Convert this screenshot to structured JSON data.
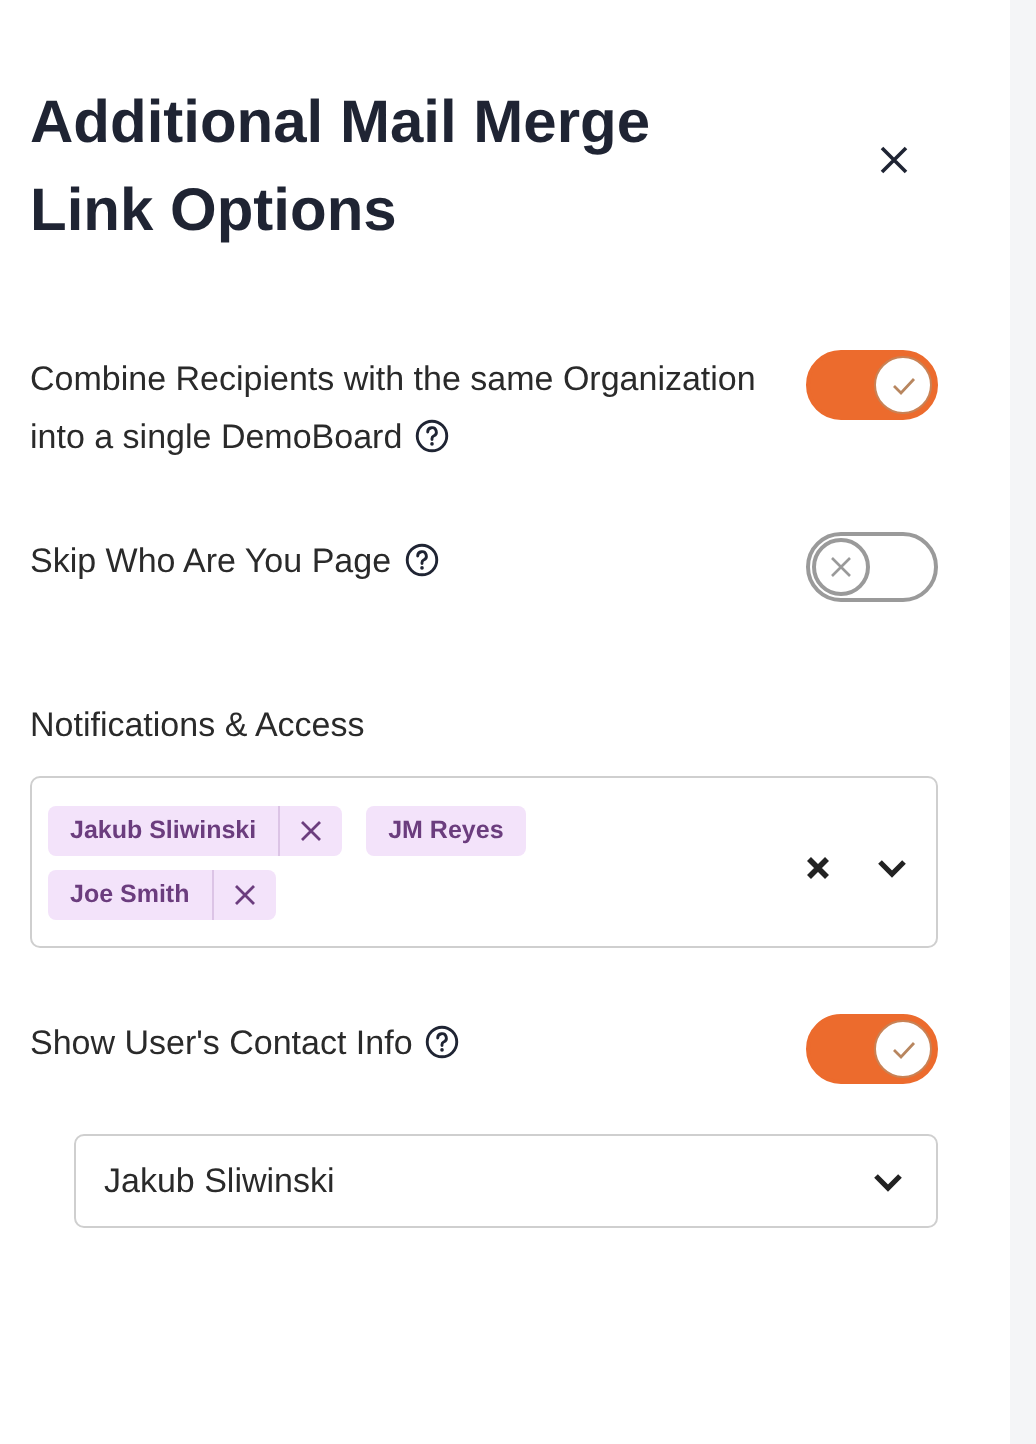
{
  "title": "Additional Mail Merge Link Options",
  "options_top": [
    {
      "label": "Combine Recipients with the same Organization into a single DemoBoard",
      "help": true,
      "on": true
    },
    {
      "label": "Skip Who Are You Page",
      "help": true,
      "on": false
    }
  ],
  "notifications": {
    "label": "Notifications & Access",
    "chips": [
      {
        "text": "Jakub Sliwinski",
        "removable": true
      },
      {
        "text": "JM Reyes",
        "removable": false
      },
      {
        "text": "Joe Smith",
        "removable": true
      }
    ]
  },
  "contact_info": {
    "label": "Show User's Contact Info",
    "help": true,
    "on": true,
    "select": {
      "value": "Jakub Sliwinski"
    }
  }
}
